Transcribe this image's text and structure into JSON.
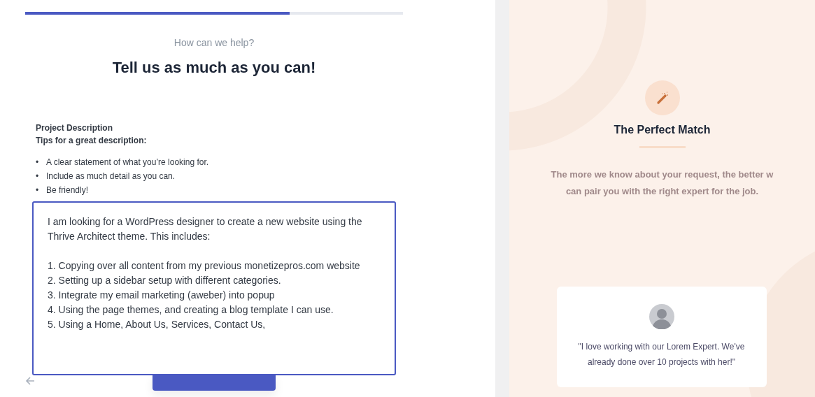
{
  "progress": {
    "level": 0.7
  },
  "form": {
    "eyebrow": "How can we help?",
    "title": "Tell us as much as you can!",
    "field_label": "Project Description",
    "tips_heading": "Tips for a great description:",
    "tips": [
      {
        "bullet": "•",
        "text": "A clear statement of what you’re looking for."
      },
      {
        "bullet": "•",
        "text": "Include as much detail as you can."
      },
      {
        "bullet": "•",
        "text": "Be friendly!"
      }
    ],
    "description": {
      "value": "I am looking for a WordPress designer to create a new website using the Thrive Architect theme. This includes:\n\n1. Copying over all content from my previous monetizepros.com website\n2. Setting up a sidebar setup with different categories.\n3. Integrate my email marketing (aweber) into popup\n4. Using the page themes, and creating a blog template I can use.\n5. Using a Home, About Us, Services, Contact Us,"
    }
  },
  "aside": {
    "title": "The Perfect Match",
    "text_lines": [
      "The more we know about your request, the better w",
      "can pair you with the right expert for the job."
    ],
    "testimonial": {
      "quote_lines": [
        "\"I love working with our Lorem Expert. We've",
        "already done over 10 projects with her!\""
      ]
    }
  }
}
